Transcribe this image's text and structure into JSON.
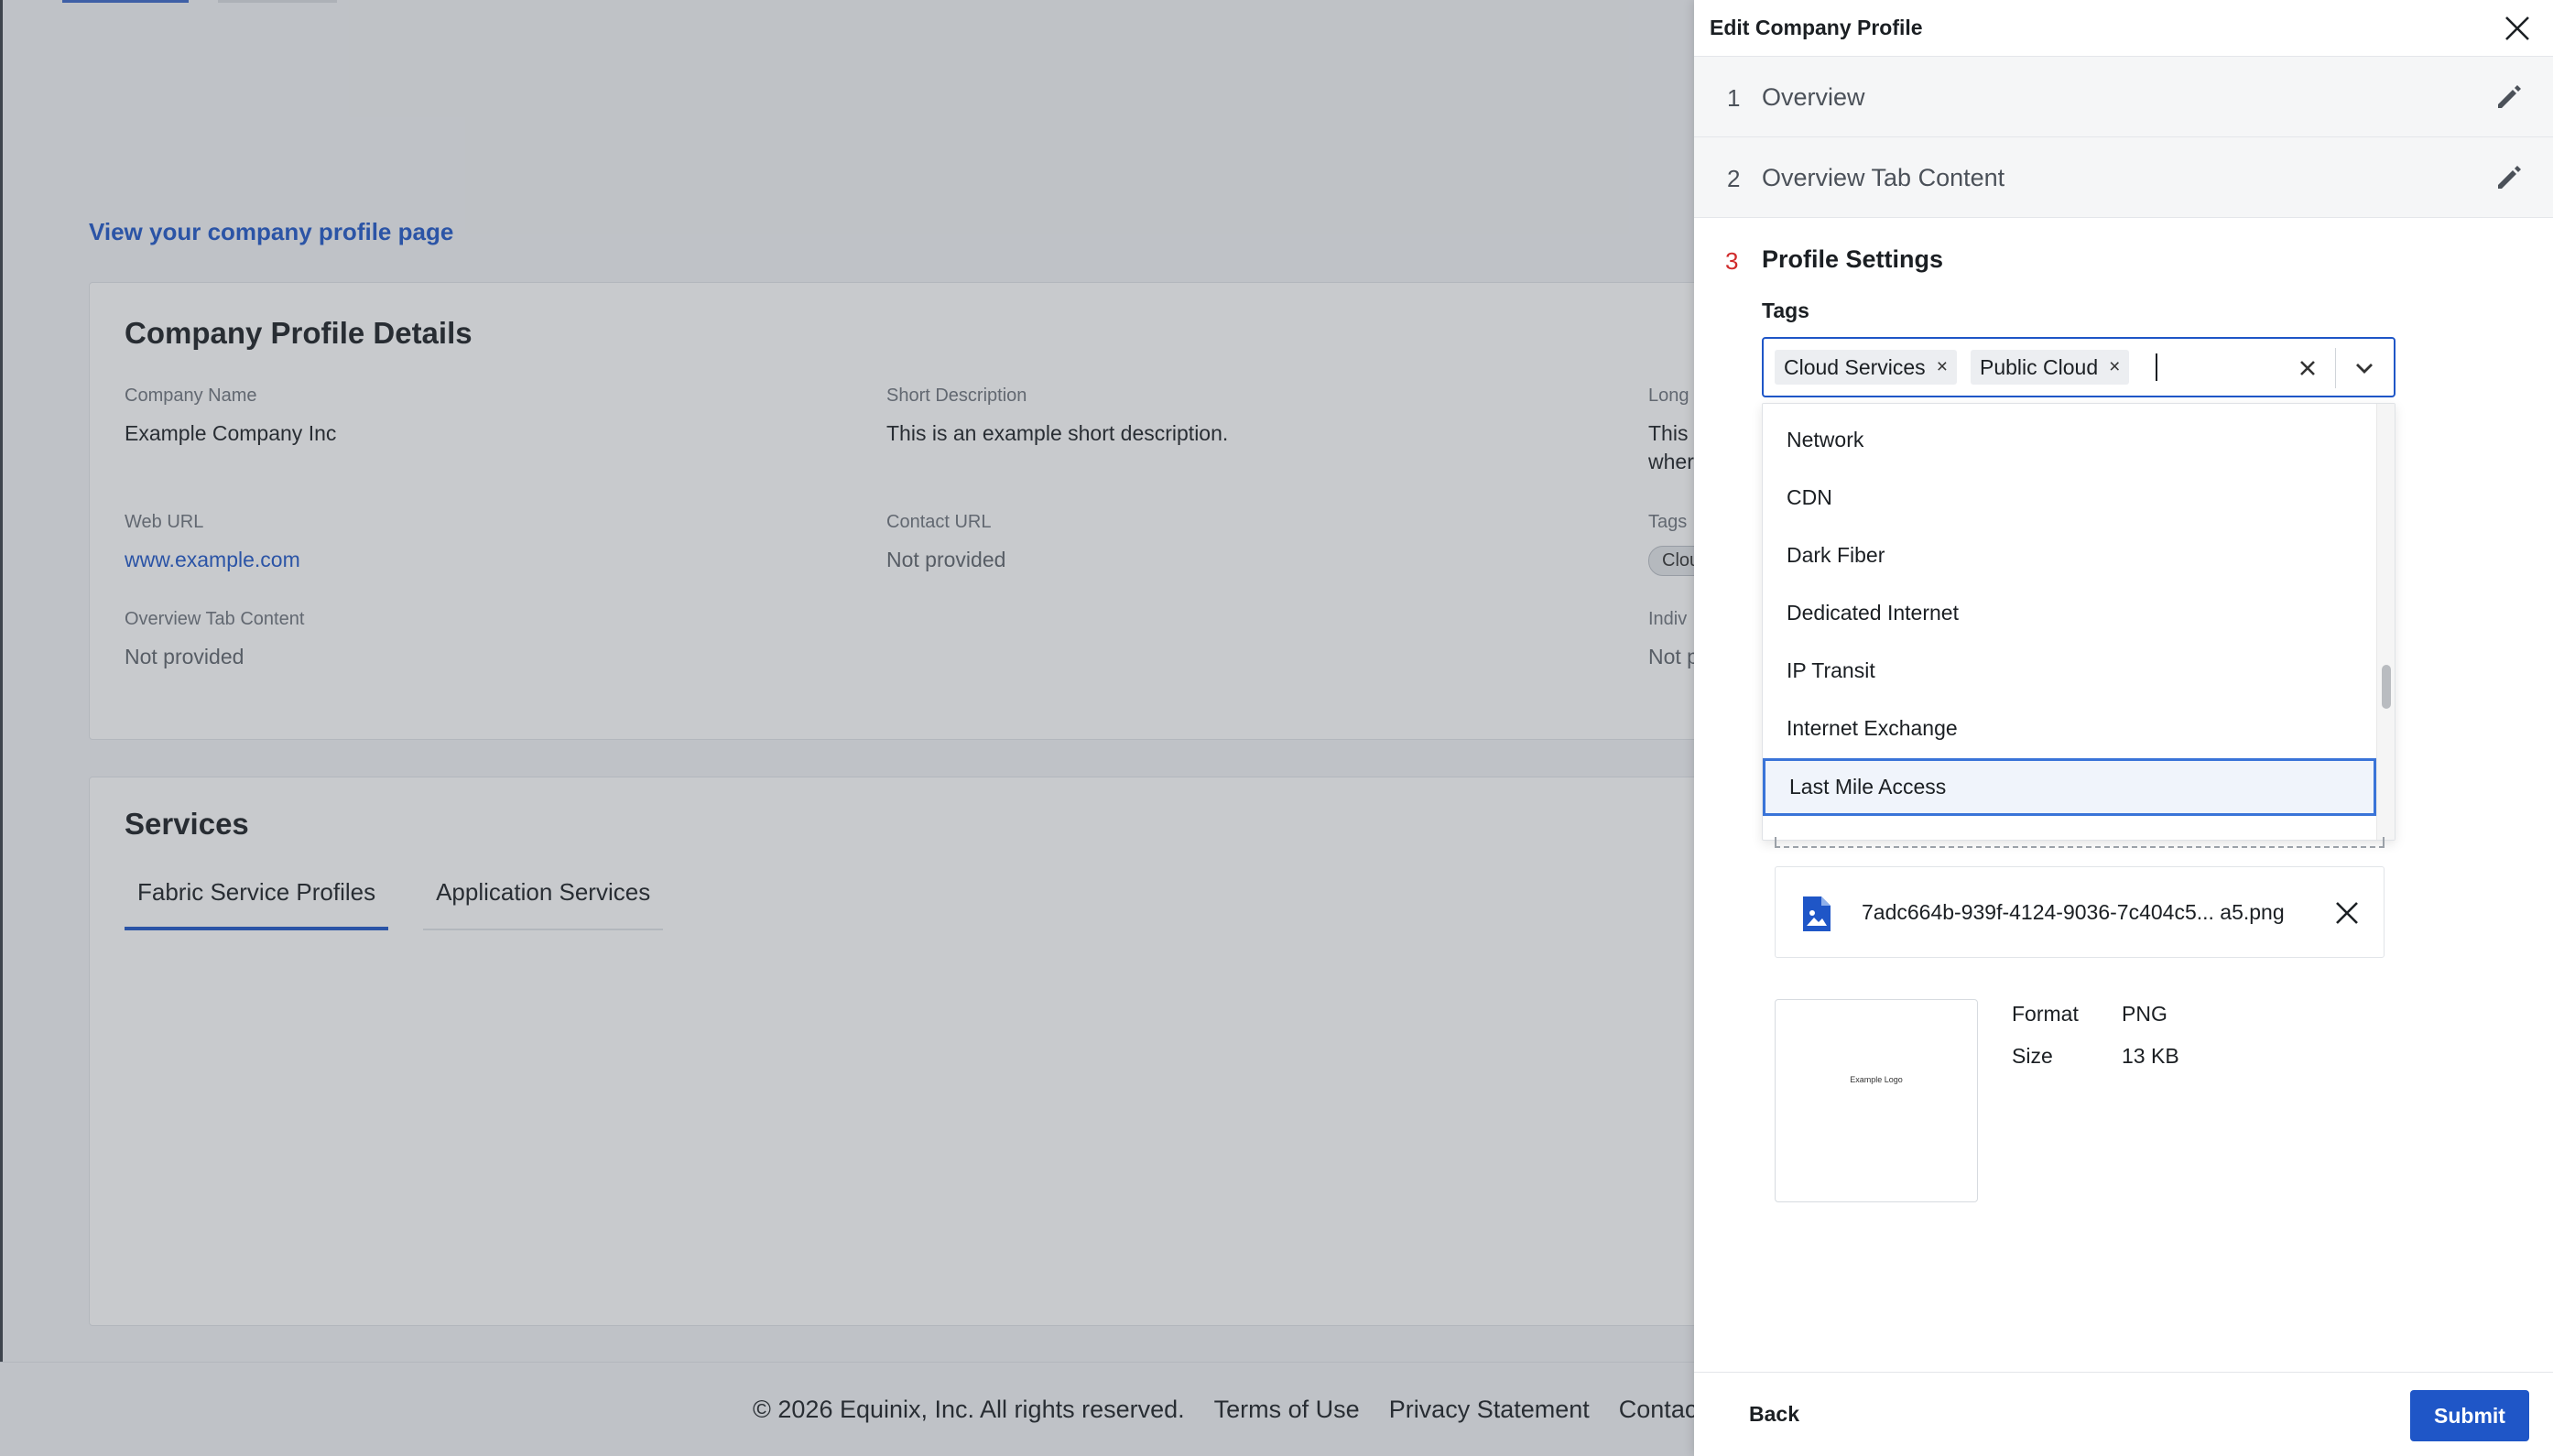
{
  "background_page": {
    "profile_link": "View your company profile page",
    "details": {
      "title": "Company Profile Details",
      "company_name_label": "Company Name",
      "company_name": "Example Company Inc",
      "short_desc_label": "Short Description",
      "short_desc": "This is an example short description.",
      "long_desc_label": "Long",
      "long_desc_line1": "This",
      "long_desc_line2": "wher",
      "web_url_label": "Web URL",
      "web_url": "www.example.com",
      "contact_url_label": "Contact URL",
      "contact_url": "Not provided",
      "tags_label": "Tags",
      "tags_pill": "Clou",
      "overview_tab_label": "Overview Tab Content",
      "overview_tab": "Not provided",
      "indiv_label": "Indiv",
      "indiv_value": "Not p"
    },
    "services": {
      "title": "Services",
      "tabs": [
        "Fabric Service Profiles",
        "Application Services"
      ]
    },
    "footer": {
      "copyright": "© 2026 Equinix, Inc. All rights reserved.",
      "terms": "Terms of Use",
      "privacy": "Privacy Statement",
      "contact": "Contact"
    }
  },
  "drawer": {
    "title": "Edit Company Profile",
    "steps": [
      {
        "num": "1",
        "name": "Overview"
      },
      {
        "num": "2",
        "name": "Overview Tab Content"
      },
      {
        "num": "3",
        "name": "Profile Settings"
      }
    ],
    "tags": {
      "label": "Tags",
      "selected": [
        "Cloud Services",
        "Public Cloud"
      ],
      "chip_remove": "×",
      "options": [
        "Network",
        "CDN",
        "Dark Fiber",
        "Dedicated Internet",
        "IP Transit",
        "Internet Exchange",
        "Last Mile Access"
      ],
      "focused_option": "Last Mile Access"
    },
    "file": {
      "name": "7adc664b-939f-4124-9036-7c404c5... a5.png",
      "thumb_text": "Example Logo",
      "format_label": "Format",
      "format": "PNG",
      "size_label": "Size",
      "size": "13 KB"
    },
    "back_label": "Back",
    "submit_label": "Submit"
  },
  "colors": {
    "accent": "#1f56c7",
    "step_active_number": "#d02b2b"
  },
  "icons": [
    "close-icon",
    "pencil-icon",
    "clear-icon",
    "chevron-down-icon",
    "image-file-icon"
  ]
}
